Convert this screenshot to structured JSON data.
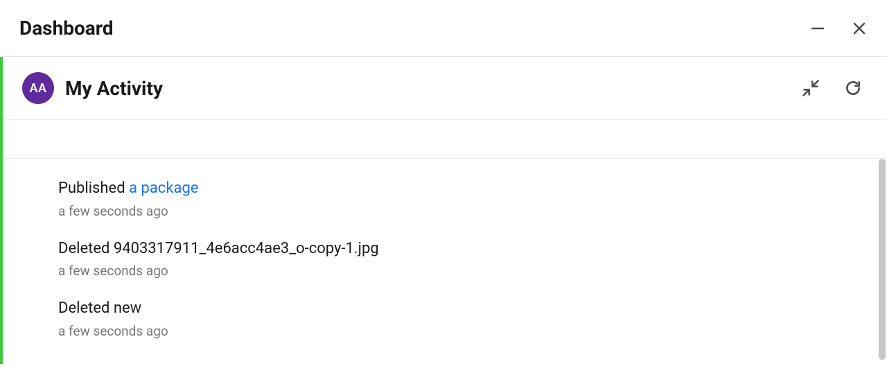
{
  "header": {
    "title": "Dashboard"
  },
  "panel": {
    "avatar_initials": "AA",
    "title": "My Activity"
  },
  "activities": [
    {
      "prefix": "Published ",
      "link": "a package",
      "suffix": "",
      "time": "a few seconds ago"
    },
    {
      "prefix": "Deleted 9403317911_4e6acc4ae3_o-copy-1.jpg",
      "link": "",
      "suffix": "",
      "time": "a few seconds ago"
    },
    {
      "prefix": "Deleted new",
      "link": "",
      "suffix": "",
      "time": "a few seconds ago"
    }
  ]
}
